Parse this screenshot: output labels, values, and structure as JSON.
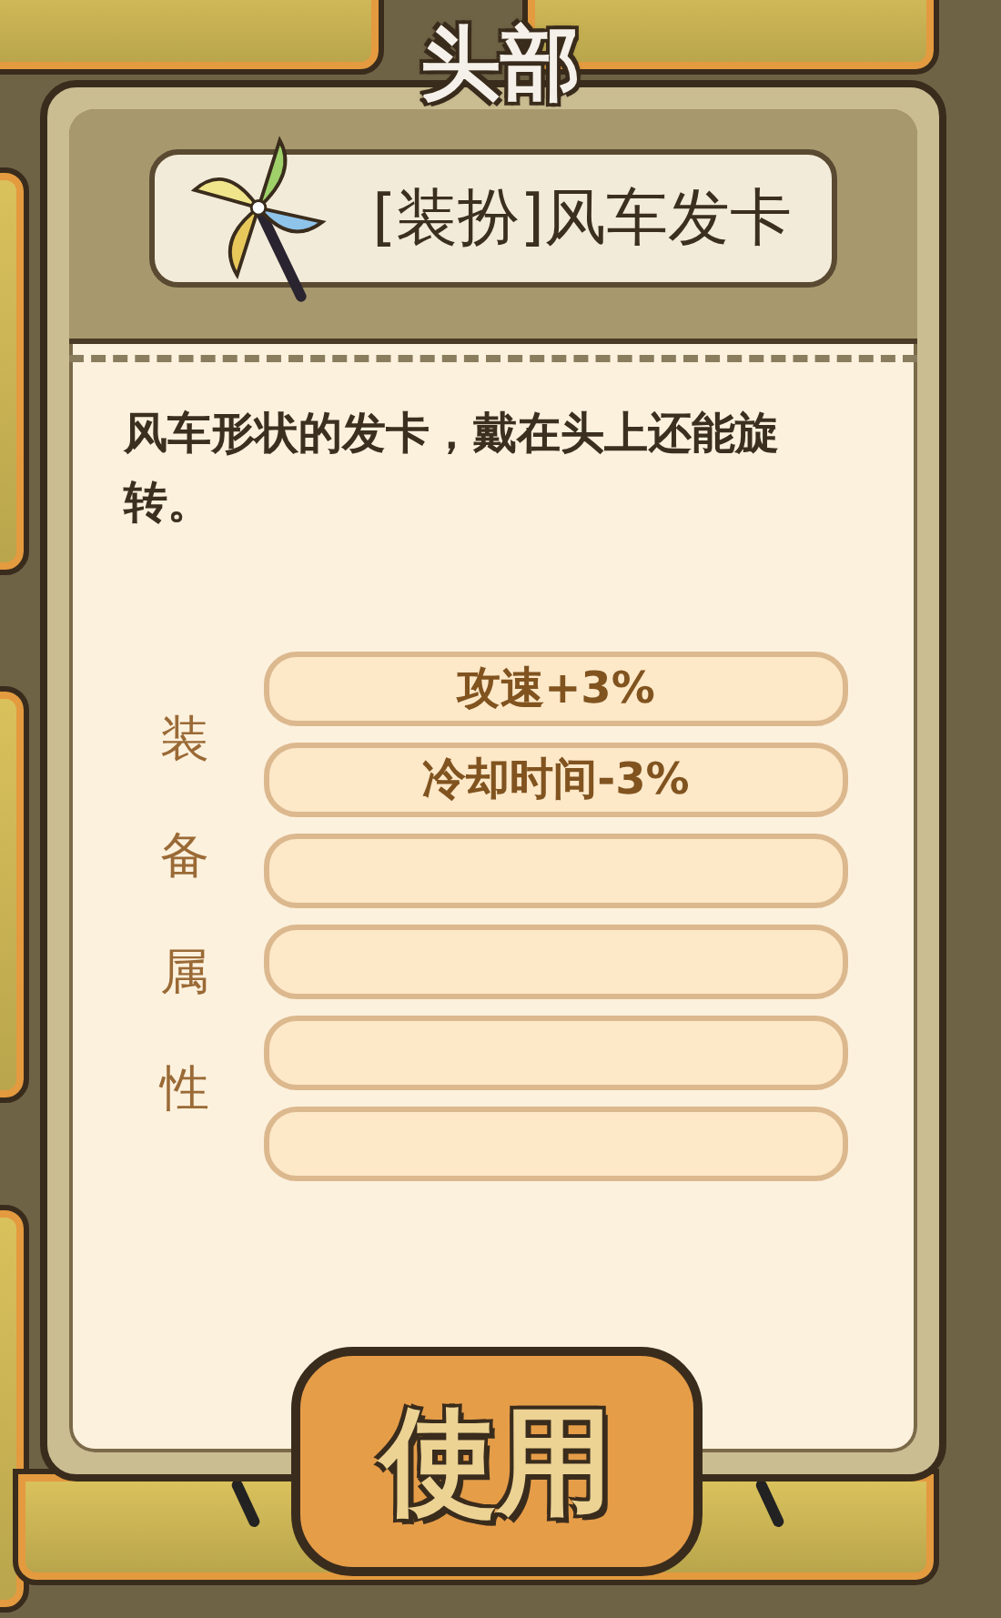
{
  "title": "头部",
  "item": {
    "name": "[装扮]风车发卡",
    "description": "风车形状的发卡，戴在头上还能旋转。"
  },
  "attributes": {
    "label": "装备属性",
    "rows": [
      {
        "kind": "filled",
        "text": "攻速+3%"
      },
      {
        "kind": "filled",
        "text": "冷却时间-3%"
      },
      {
        "kind": "empty"
      },
      {
        "kind": "empty"
      },
      {
        "kind": "empty"
      },
      {
        "kind": "empty"
      }
    ]
  },
  "button": "使用"
}
